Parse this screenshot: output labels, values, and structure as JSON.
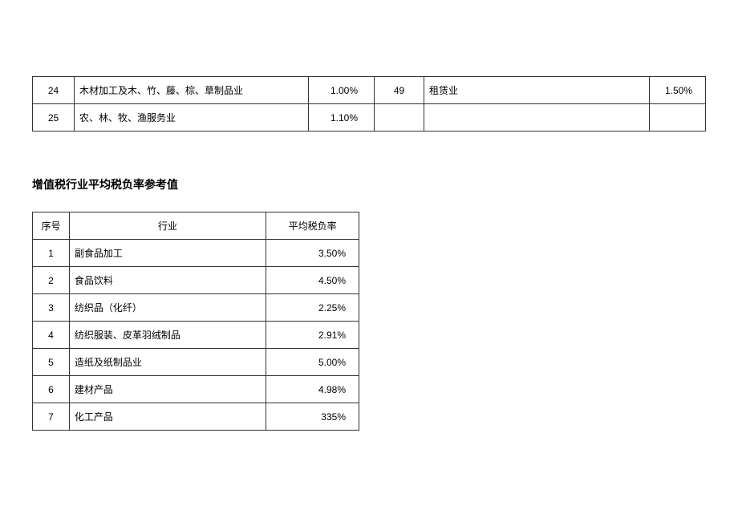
{
  "top_rows": [
    {
      "left_no": "24",
      "left_name": "木材加工及木、竹、藤、棕、草制品业",
      "left_val": "1.00%",
      "right_no": "49",
      "right_name": "租赁业",
      "right_val": "1.50%"
    },
    {
      "left_no": "25",
      "left_name": "农、林、牧、渔服务业",
      "left_val": "1.10%",
      "right_no": "",
      "right_name": "",
      "right_val": ""
    }
  ],
  "section_title": "增值税行业平均税负率参考值",
  "table": {
    "headers": {
      "no": "序号",
      "industry": "行业",
      "rate": "平均税负率"
    },
    "rows": [
      {
        "no": "1",
        "industry": "副食品加工",
        "rate": "3.50%"
      },
      {
        "no": "2",
        "industry": "食品饮料",
        "rate": "4.50%"
      },
      {
        "no": "3",
        "industry": "纺织品（化纤）",
        "rate": "2.25%"
      },
      {
        "no": "4",
        "industry": "纺织服装、皮革羽绒制品",
        "rate": "2.91%"
      },
      {
        "no": "5",
        "industry": "造纸及纸制品业",
        "rate": "5.00%"
      },
      {
        "no": "6",
        "industry": "建材产品",
        "rate": "4.98%"
      },
      {
        "no": "7",
        "industry": "化工产品",
        "rate": "335%"
      }
    ]
  }
}
